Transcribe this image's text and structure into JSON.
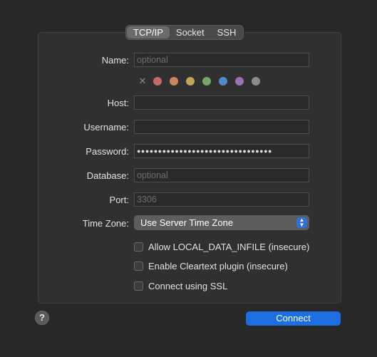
{
  "tabs": [
    {
      "label": "TCP/IP",
      "active": true
    },
    {
      "label": "Socket",
      "active": false
    },
    {
      "label": "SSH",
      "active": false
    }
  ],
  "form": {
    "name_label": "Name:",
    "name_placeholder": "optional",
    "name_value": "",
    "host_label": "Host:",
    "host_value": "",
    "username_label": "Username:",
    "username_value": "",
    "password_label": "Password:",
    "password_value": "●●●●●●●●●●●●●●●●●●●●●●●●●●●●●●●●",
    "database_label": "Database:",
    "database_placeholder": "optional",
    "database_value": "",
    "port_label": "Port:",
    "port_placeholder": "3306",
    "port_value": "",
    "timezone_label": "Time Zone:",
    "timezone_value": "Use Server Time Zone"
  },
  "colors": {
    "clear_icon": "x-icon",
    "swatches": [
      "#c46a6a",
      "#c9895c",
      "#c2a45a",
      "#78a565",
      "#4f8bc8",
      "#9a73ad",
      "#8b8b8b"
    ]
  },
  "options": [
    {
      "label": "Allow LOCAL_DATA_INFILE (insecure)",
      "checked": false
    },
    {
      "label": "Enable Cleartext plugin (insecure)",
      "checked": false
    },
    {
      "label": "Connect using SSL",
      "checked": false
    }
  ],
  "footer": {
    "help_icon": "question-icon",
    "help_glyph": "?",
    "connect_label": "Connect"
  },
  "theme": {
    "accent": "#1d6ee0",
    "background": "#282828",
    "panel": "#303030"
  }
}
